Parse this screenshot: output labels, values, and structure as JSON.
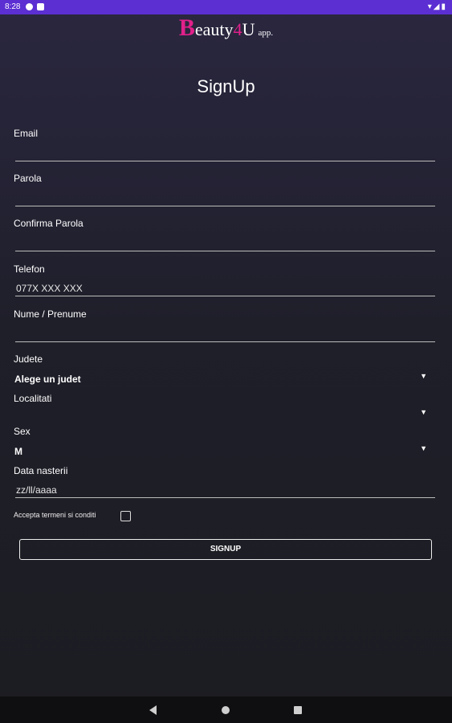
{
  "status_bar": {
    "time": "8:28"
  },
  "logo": {
    "b": "B",
    "eauty": "eauty",
    "four": "4",
    "u": "U",
    "app": "app."
  },
  "title": "SignUp",
  "fields": {
    "email": {
      "label": "Email",
      "value": ""
    },
    "password": {
      "label": "Parola",
      "value": ""
    },
    "confirm_password": {
      "label": "Confirma Parola",
      "value": ""
    },
    "phone": {
      "label": "Telefon",
      "placeholder": "077X XXX XXX"
    },
    "name": {
      "label": "Nume / Prenume",
      "value": ""
    },
    "county": {
      "label": "Judete",
      "value": "Alege un judet"
    },
    "locality": {
      "label": "Localitati",
      "value": ""
    },
    "sex": {
      "label": "Sex",
      "value": "M"
    },
    "birthdate": {
      "label": "Data nasterii",
      "placeholder": "zz/ll/aaaa"
    }
  },
  "terms": {
    "label": "Accepta termeni si conditi",
    "checked": false
  },
  "signup_button": "SIGNUP",
  "colors": {
    "status_bar": "#5b2fd2",
    "logo_accent": "#e0208a",
    "background_top": "#2a2740",
    "background_bottom": "#1c1c22"
  }
}
